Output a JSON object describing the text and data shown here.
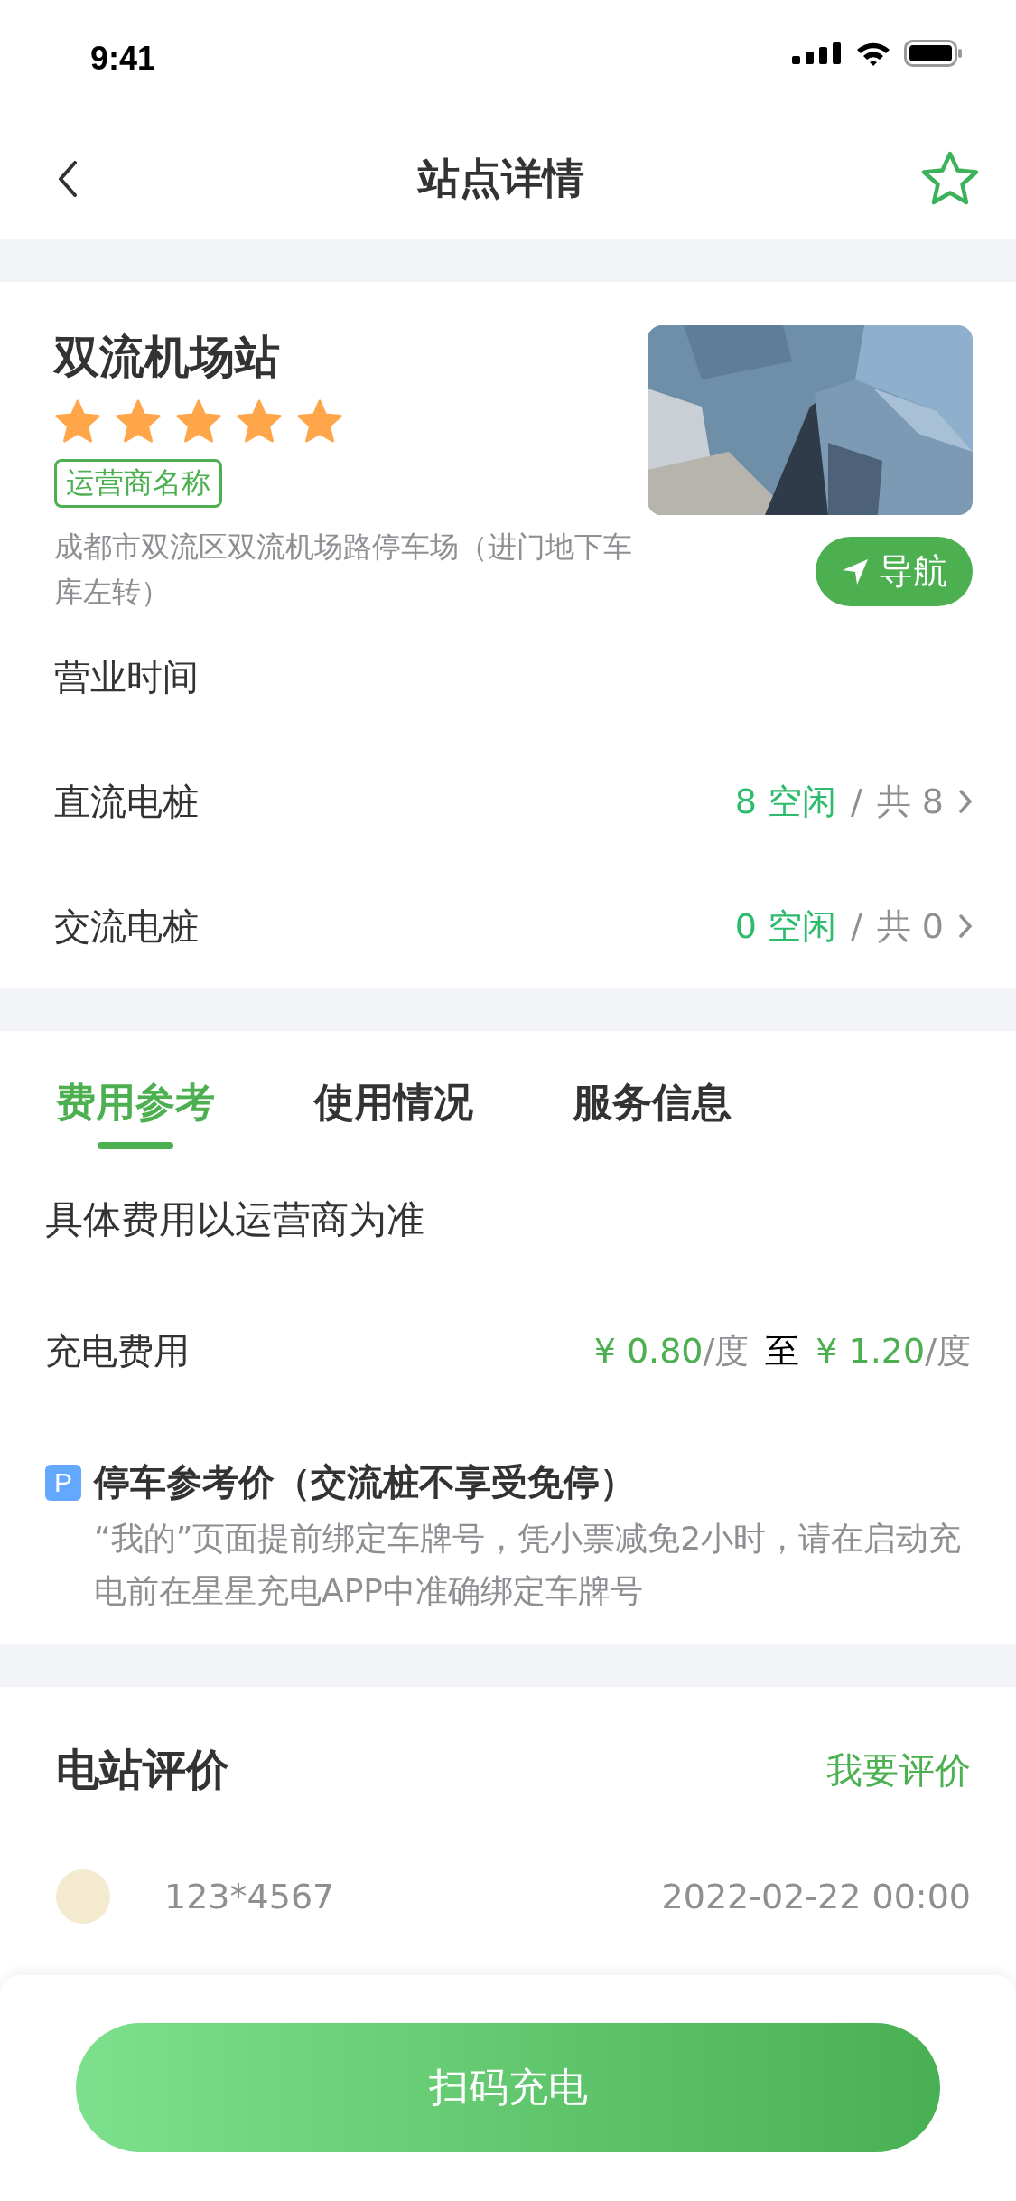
{
  "status_bar": {
    "time": "9:41"
  },
  "nav": {
    "title": "站点详情"
  },
  "station": {
    "name": "双流机场站",
    "stars": 5,
    "operator_tag": "运营商名称",
    "address": "成都市双流区双流机场路停车场（进门地下车库左转）",
    "navigate_label": "导航"
  },
  "info_rows": [
    {
      "label": "营业时间"
    },
    {
      "label": "直流电桩",
      "free": "8 空闲",
      "separator": "/",
      "total": "共 8"
    },
    {
      "label": "交流电桩",
      "free": "0 空闲",
      "separator": "/",
      "total": "共 0"
    }
  ],
  "tabs": [
    {
      "label": "费用参考",
      "selected": true
    },
    {
      "label": "使用情况",
      "selected": false
    },
    {
      "label": "服务信息",
      "selected": false
    }
  ],
  "fees": {
    "note": "具体费用以运营商为准",
    "charge_label": "充电费用",
    "price_from": "¥ 0.80",
    "unit_from": "/度",
    "range_word": "至",
    "price_to": "¥ 1.20",
    "unit_to": "/度"
  },
  "parking": {
    "badge": "P",
    "title": "停车参考价（交流桩不享受免停）",
    "description": "“我的”页面提前绑定车牌号，凭小票减免2小时，请在启动充电前在星星充电APP中准确绑定车牌号"
  },
  "reviews": {
    "title": "电站评价",
    "action": "我要评价",
    "items": [
      {
        "user": "123*4567",
        "date": "2022-02-22 00:00"
      }
    ]
  },
  "bottom_button": "扫码充电"
}
